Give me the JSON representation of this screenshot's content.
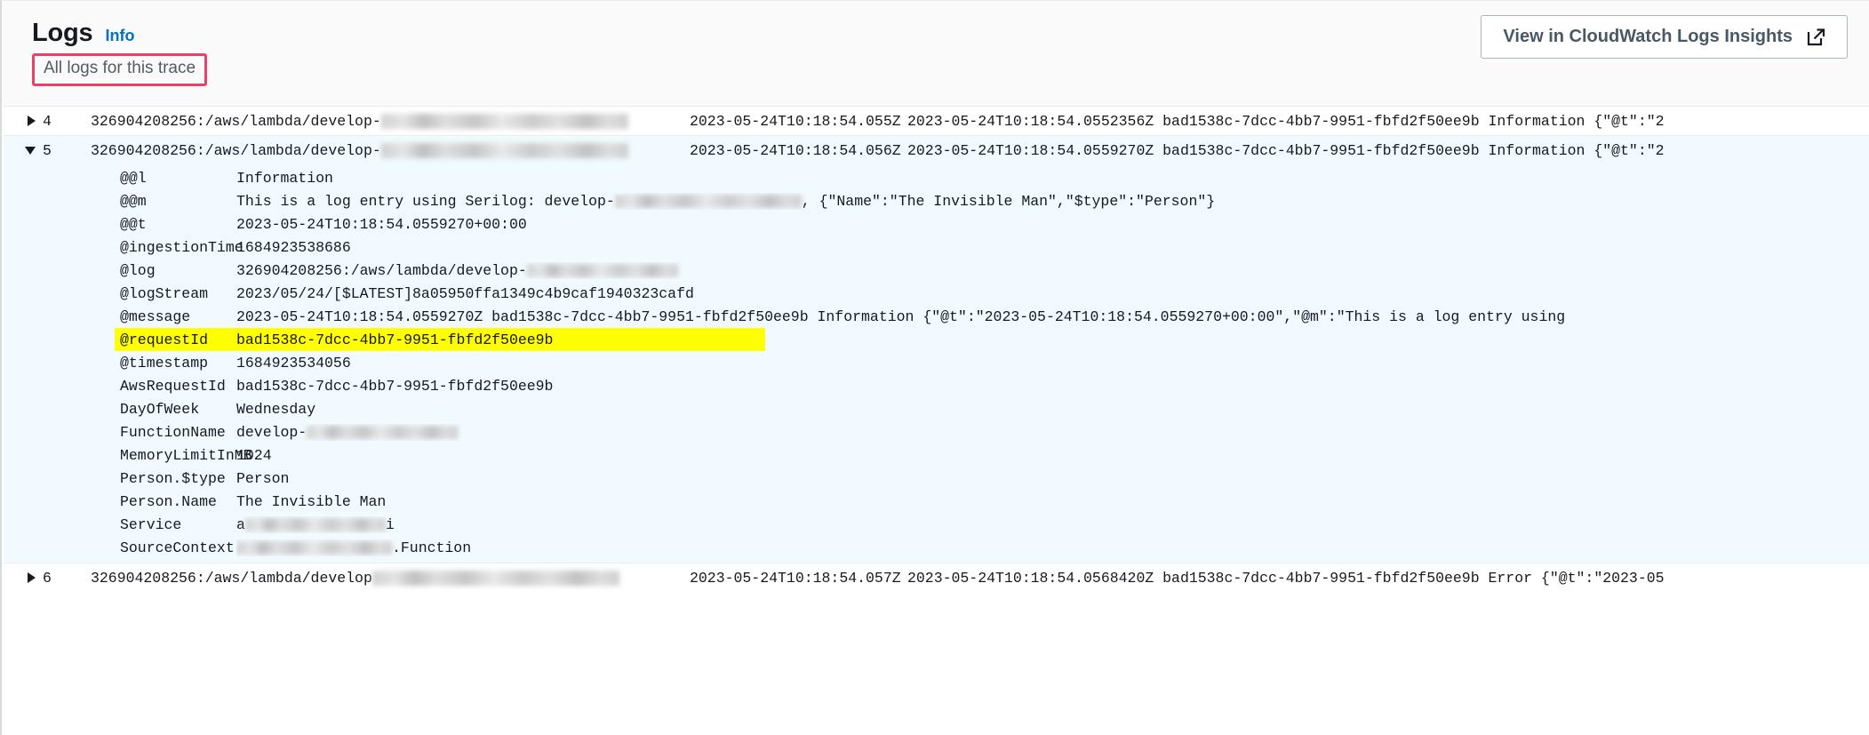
{
  "header": {
    "title": "Logs",
    "info_link": "Info",
    "subtitle": "All logs for this trace",
    "subtitle_highlight_color": "#e8416a",
    "insights_button_label": "View in CloudWatch Logs Insights",
    "insights_button_icon": "external-link-icon"
  },
  "table": {
    "rows": [
      {
        "number": "4",
        "expanded": false,
        "caret_icon": "chevron-right-icon",
        "log_group_prefix": "326904208256:/aws/lambda/develop-",
        "log_group_redacted": true,
        "timestamp": "2023-05-24T10:18:54.055Z",
        "message": "2023-05-24T10:18:54.0552356Z bad1538c-7dcc-4bb7-9951-fbfd2f50ee9b Information {\"@t\":\"2",
        "selected": false
      },
      {
        "number": "5",
        "expanded": true,
        "caret_icon": "chevron-down-icon",
        "log_group_prefix": "326904208256:/aws/lambda/develop-",
        "log_group_redacted": true,
        "timestamp": "2023-05-24T10:18:54.056Z",
        "message": "2023-05-24T10:18:54.0559270Z bad1538c-7dcc-4bb7-9951-fbfd2f50ee9b Information {\"@t\":\"2",
        "selected": true
      },
      {
        "number": "6",
        "expanded": false,
        "caret_icon": "chevron-right-icon",
        "log_group_prefix": "326904208256:/aws/lambda/develop",
        "log_group_redacted": true,
        "timestamp": "2023-05-24T10:18:54.057Z",
        "message": "2023-05-24T10:18:54.0568420Z bad1538c-7dcc-4bb7-9951-fbfd2f50ee9b Error {\"@t\":\"2023-05",
        "selected": false
      }
    ],
    "detail_fields": [
      {
        "key": "@@l",
        "value": "Information",
        "highlighted": false,
        "redacted": false
      },
      {
        "key": "@@m",
        "value_prefix": "This is a log entry using Serilog: develop-",
        "value_suffix": ", {\"Name\":\"The Invisible Man\",\"$type\":\"Person\"}",
        "highlighted": false,
        "redacted": true,
        "redact_width": 210
      },
      {
        "key": "@@t",
        "value": "2023-05-24T10:18:54.0559270+00:00",
        "highlighted": false,
        "redacted": false
      },
      {
        "key": "@ingestionTime",
        "value": "1684923538686",
        "highlighted": false,
        "redacted": false
      },
      {
        "key": "@log",
        "value_prefix": "326904208256:/aws/lambda/develop-",
        "value_suffix": "",
        "highlighted": false,
        "redacted": true,
        "redact_width": 170
      },
      {
        "key": "@logStream",
        "value": "2023/05/24/[$LATEST]8a05950ffa1349c4b9caf1940323cafd",
        "highlighted": false,
        "redacted": false
      },
      {
        "key": "@message",
        "value": "2023-05-24T10:18:54.0559270Z bad1538c-7dcc-4bb7-9951-fbfd2f50ee9b Information {\"@t\":\"2023-05-24T10:18:54.0559270+00:00\",\"@m\":\"This is a log entry using",
        "highlighted": false,
        "redacted": false
      },
      {
        "key": "@requestId",
        "value": "bad1538c-7dcc-4bb7-9951-fbfd2f50ee9b",
        "highlighted": true,
        "highlight_color": "#ffff00",
        "redacted": false
      },
      {
        "key": "@timestamp",
        "value": "1684923534056",
        "highlighted": false,
        "redacted": false
      },
      {
        "key": "AwsRequestId",
        "value": "bad1538c-7dcc-4bb7-9951-fbfd2f50ee9b",
        "highlighted": false,
        "redacted": false
      },
      {
        "key": "DayOfWeek",
        "value": "Wednesday",
        "highlighted": false,
        "redacted": false
      },
      {
        "key": "FunctionName",
        "value_prefix": "develop-",
        "value_suffix": "",
        "highlighted": false,
        "redacted": true,
        "redact_width": 170
      },
      {
        "key": "MemoryLimitInMB",
        "value": "1024",
        "highlighted": false,
        "redacted": false
      },
      {
        "key": "Person.$type",
        "value": "Person",
        "highlighted": false,
        "redacted": false
      },
      {
        "key": "Person.Name",
        "value": "The Invisible Man",
        "highlighted": false,
        "redacted": false
      },
      {
        "key": "Service",
        "value_prefix": "a",
        "value_suffix": "i",
        "highlighted": false,
        "redacted": true,
        "redact_width": 158
      },
      {
        "key": "SourceContext",
        "value_prefix": "",
        "value_suffix": ".Function",
        "highlighted": false,
        "redacted": true,
        "redact_width": 175
      }
    ]
  }
}
